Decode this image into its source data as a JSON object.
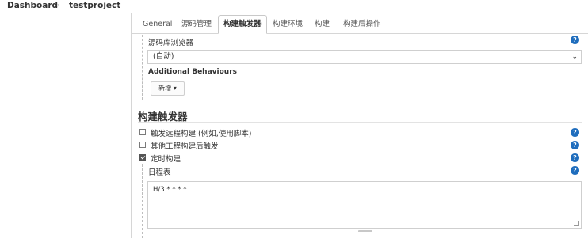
{
  "breadcrumb": {
    "items": [
      "Dashboard",
      "testproject"
    ],
    "separator": "›"
  },
  "tabs": [
    {
      "label": "General",
      "active": false
    },
    {
      "label": "源码管理",
      "active": false
    },
    {
      "label": "构建触发器",
      "active": true
    },
    {
      "label": "构建环境",
      "active": false
    },
    {
      "label": "构建",
      "active": false
    },
    {
      "label": "构建后操作",
      "active": false
    }
  ],
  "scm": {
    "repo_browser_label": "源码库浏览器",
    "repo_browser_value": "(自动)",
    "additional_behaviours_label": "Additional Behaviours",
    "add_button_label": "新增 ▾"
  },
  "triggers": {
    "section_title": "构建触发器",
    "options": [
      {
        "label": "触发远程构建 (例如,使用脚本)",
        "checked": false
      },
      {
        "label": "其他工程构建后触发",
        "checked": false
      },
      {
        "label": "定时构建",
        "checked": true
      }
    ],
    "schedule_label": "日程表",
    "schedule_value": "H/3 * * * *"
  },
  "help_icon_glyph": "?",
  "colors": {
    "help_icon": "#1f6dbd",
    "border": "#cfcfcf",
    "text": "#333333"
  }
}
